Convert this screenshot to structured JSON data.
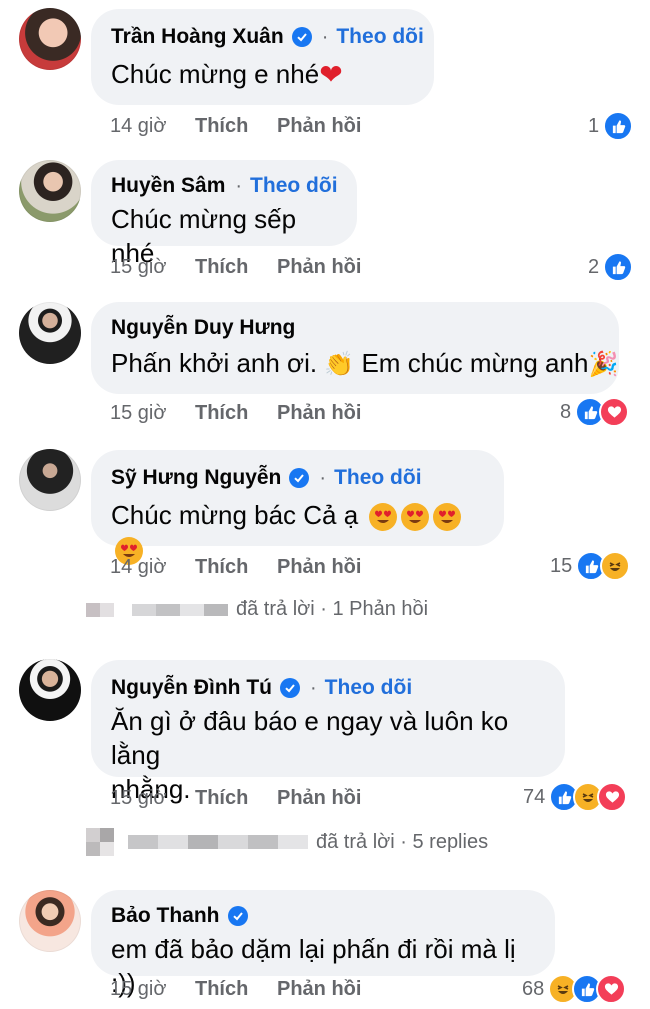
{
  "comments": [
    {
      "name": "Trần Hoàng Xuân",
      "verified": true,
      "follow": "Theo dõi",
      "text": "Chúc mừng e nhé",
      "time": "14 giờ",
      "like": "Thích",
      "reply": "Phản hồi",
      "count": "1"
    },
    {
      "name": "Huyền Sâm",
      "verified": false,
      "follow": "Theo dõi",
      "text": "Chúc mừng sếp nhé",
      "time": "15 giờ",
      "like": "Thích",
      "reply": "Phản hồi",
      "count": "2"
    },
    {
      "name": "Nguyễn Duy Hưng",
      "verified": false,
      "follow": "",
      "text_a": "Phấn khởi anh ơi.",
      "text_b": "Em chúc mừng anh",
      "time": "15 giờ",
      "like": "Thích",
      "reply": "Phản hồi",
      "count": "8"
    },
    {
      "name": "Sỹ Hưng Nguyễn",
      "verified": true,
      "follow": "Theo dõi",
      "text": "Chúc mừng bác Cả ạ",
      "time": "14 giờ",
      "like": "Thích",
      "reply": "Phản hồi",
      "count": "15"
    },
    {
      "name": "Nguyễn Đình Tú",
      "verified": true,
      "follow": "Theo dõi",
      "text_line1": "Ăn gì ở đâu báo e ngay và luôn ko lằng",
      "text_line2": "nhằng.",
      "time": "15 giờ",
      "like": "Thích",
      "reply": "Phản hồi",
      "count": "74"
    },
    {
      "name": "Bảo Thanh",
      "verified": true,
      "follow": "",
      "text": "em đã bảo dặm lại phấn đi rồi mà lị :))",
      "time": "15 giờ",
      "like": "Thích",
      "reply": "Phản hồi",
      "count": "68"
    }
  ],
  "reply_rows": [
    {
      "text": "đã trả lời · 1 Phản hồi"
    },
    {
      "text": "đã trả lời · 5 replies"
    }
  ],
  "colors": {
    "accent": "#216fdb",
    "bubble": "#f0f2f5",
    "meta": "#65676b",
    "like": "#1877f2",
    "love": "#f33e58",
    "haha": "#f7b125"
  }
}
